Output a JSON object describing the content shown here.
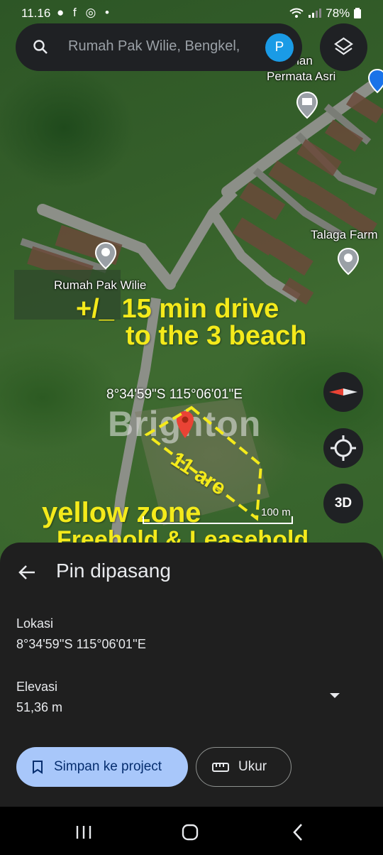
{
  "status_bar": {
    "time": "11.16",
    "app_icons": "● f ◎ •",
    "battery": "78%"
  },
  "search": {
    "placeholder": "Rumah Pak Wilie, Bengkel,",
    "avatar_letter": "P",
    "icon": "search-icon"
  },
  "map": {
    "places": [
      {
        "name": "Permata Asri",
        "name_partial": "uhan"
      },
      {
        "name": "Talaga Farm"
      },
      {
        "name": "Rumah Pak Wilie"
      }
    ],
    "pin_coordinates": "8°34'59\"S 115°06'01\"E",
    "watermark": "Brighton",
    "annotations": {
      "drive_line1": "+/_ 15 min drive",
      "drive_line2": "to the 3 beach",
      "area": "11 are",
      "zone": "yellow zone",
      "tenure": "Freehold & Leasehold"
    },
    "scale": "100 m",
    "compass_icon": "compass-icon",
    "location_icon": "my-location-icon",
    "view_3d_label": "3D",
    "accent_yellow": "#f4ea1b",
    "pin_color": "#ea4335"
  },
  "sheet": {
    "title": "Pin dipasang",
    "location_label": "Lokasi",
    "location_value": "8°34'59''S 115°06'01''E",
    "elevation_label": "Elevasi",
    "elevation_value": "51,36 m",
    "save_button": "Simpan ke project",
    "measure_button": "Ukur"
  },
  "navbar": {
    "recents_icon": "recents-icon",
    "home_icon": "home-icon",
    "back_icon": "back-icon"
  }
}
